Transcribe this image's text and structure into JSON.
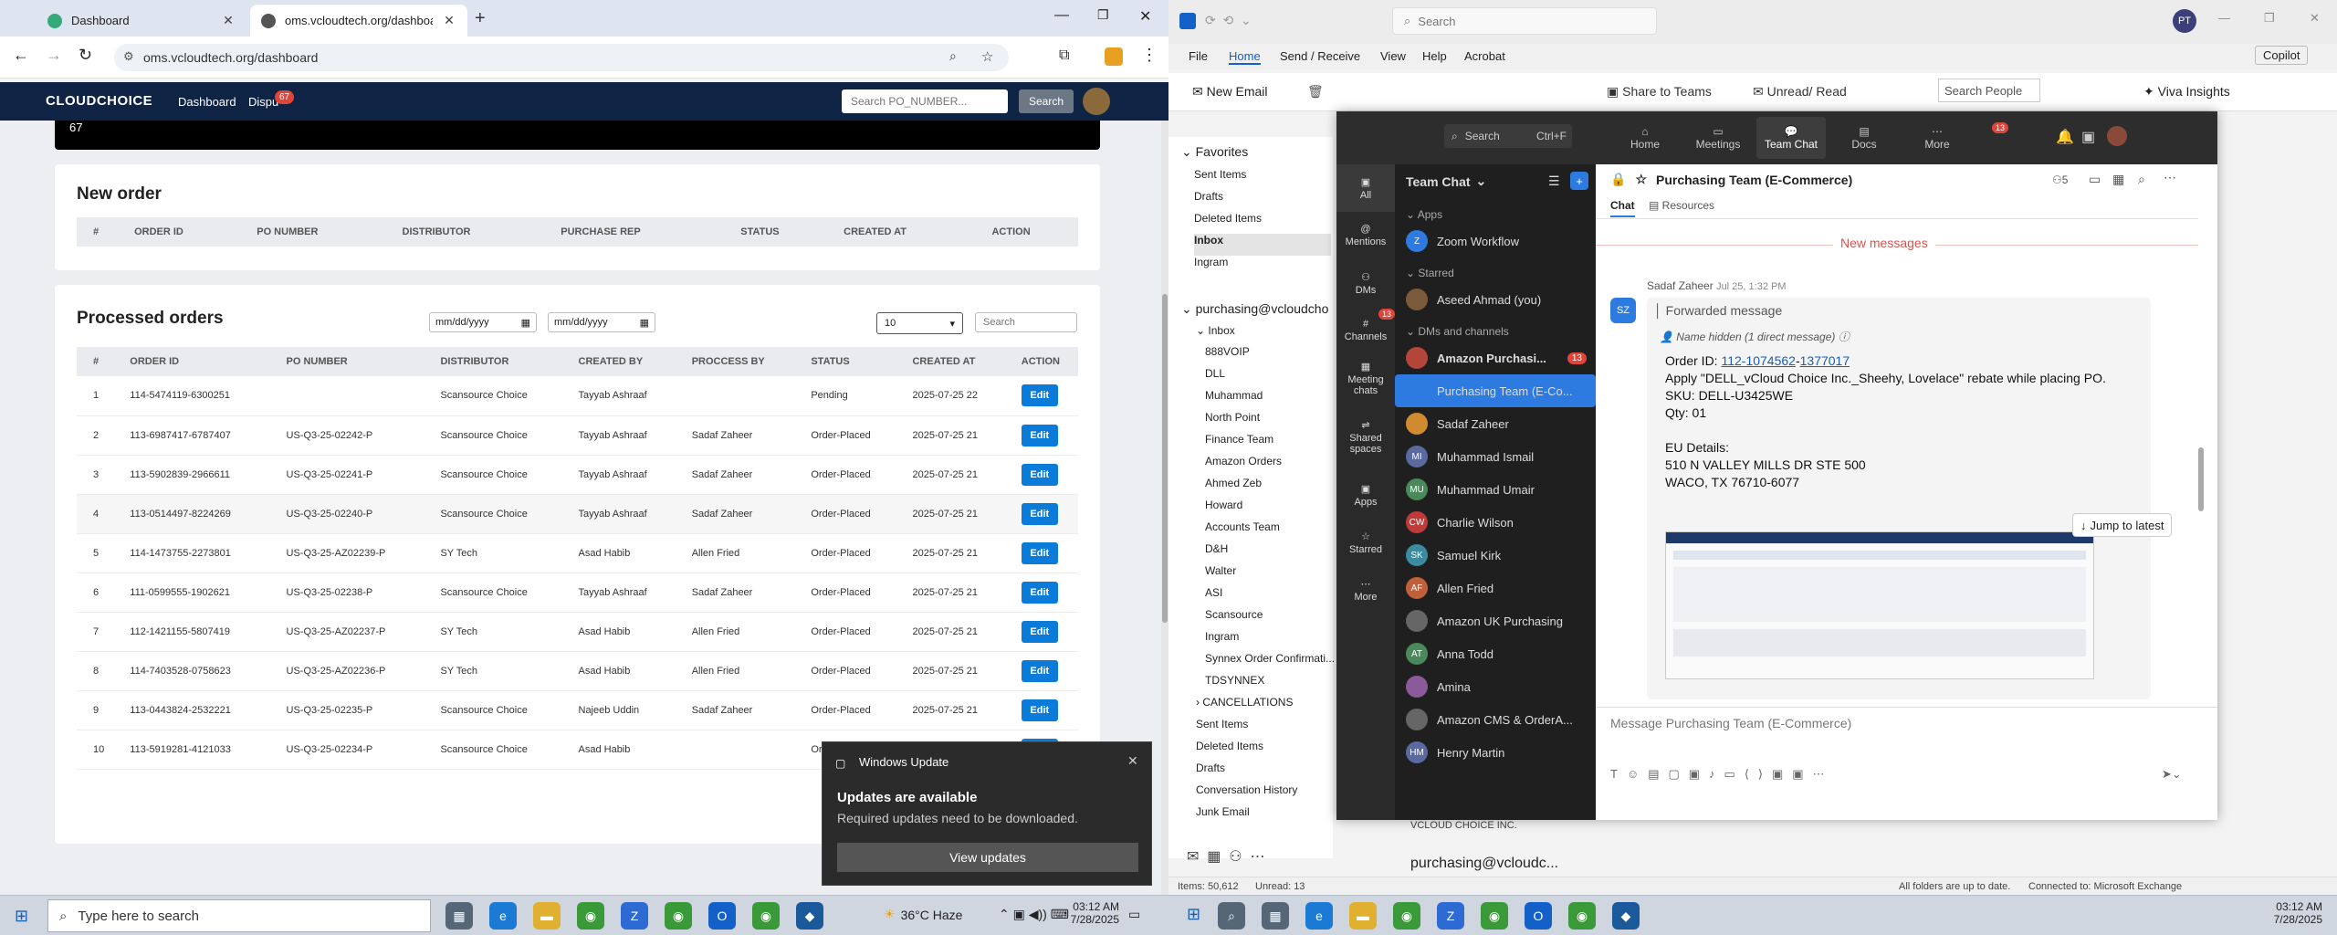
{
  "browser": {
    "tabs": [
      {
        "label": "Dashboard",
        "active": false
      },
      {
        "label": "oms.vcloudtech.org/dashboard",
        "active": true
      }
    ],
    "url": "oms.vcloudtech.org/dashboard",
    "app": {
      "logo": "CLOUDCHOICE",
      "nav_dashboard": "Dashboard",
      "nav_disputes": "Dispu",
      "disputes_count": "67",
      "search_placeholder": "Search PO_NUMBER...",
      "search_btn": "Search",
      "top_card_number": "67"
    },
    "new_order": {
      "title": "New order",
      "headers": [
        "#",
        "ORDER ID",
        "PO NUMBER",
        "DISTRIBUTOR",
        "PURCHASE REP",
        "STATUS",
        "CREATED AT",
        "ACTION"
      ]
    },
    "processed": {
      "title": "Processed orders",
      "date_placeholder_1": "mm/dd/yyyy",
      "date_placeholder_2": "mm/dd/yyyy",
      "page_size": "10",
      "search_placeholder": "Search",
      "headers": [
        "#",
        "ORDER ID",
        "PO NUMBER",
        "DISTRIBUTOR",
        "CREATED BY",
        "PROCCESS BY",
        "STATUS",
        "CREATED AT",
        "ACTION"
      ],
      "rows": [
        [
          "1",
          "114-5474119-6300251",
          "",
          "Scansource Choice",
          "Tayyab Ashraaf",
          "",
          "Pending",
          "2025-07-25 22",
          "Edit"
        ],
        [
          "2",
          "113-6987417-6787407",
          "US-Q3-25-02242-P",
          "Scansource Choice",
          "Tayyab Ashraaf",
          "Sadaf Zaheer",
          "Order-Placed",
          "2025-07-25 21",
          "Edit"
        ],
        [
          "3",
          "113-5902839-2966611",
          "US-Q3-25-02241-P",
          "Scansource Choice",
          "Tayyab Ashraaf",
          "Sadaf Zaheer",
          "Order-Placed",
          "2025-07-25 21",
          "Edit"
        ],
        [
          "4",
          "113-0514497-8224269",
          "US-Q3-25-02240-P",
          "Scansource Choice",
          "Tayyab Ashraaf",
          "Sadaf Zaheer",
          "Order-Placed",
          "2025-07-25 21",
          "Edit"
        ],
        [
          "5",
          "114-1473755-2273801",
          "US-Q3-25-AZ02239-P",
          "SY Tech",
          "Asad Habib",
          "Allen Fried",
          "Order-Placed",
          "2025-07-25 21",
          "Edit"
        ],
        [
          "6",
          "111-0599555-1902621",
          "US-Q3-25-02238-P",
          "Scansource Choice",
          "Tayyab Ashraaf",
          "Sadaf Zaheer",
          "Order-Placed",
          "2025-07-25 21",
          "Edit"
        ],
        [
          "7",
          "112-1421155-5807419",
          "US-Q3-25-AZ02237-P",
          "SY Tech",
          "Asad Habib",
          "Allen Fried",
          "Order-Placed",
          "2025-07-25 21",
          "Edit"
        ],
        [
          "8",
          "114-7403528-0758623",
          "US-Q3-25-AZ02236-P",
          "SY Tech",
          "Asad Habib",
          "Allen Fried",
          "Order-Placed",
          "2025-07-25 21",
          "Edit"
        ],
        [
          "9",
          "113-0443824-2532221",
          "US-Q3-25-02235-P",
          "Scansource Choice",
          "Najeeb Uddin",
          "Sadaf Zaheer",
          "Order-Placed",
          "2025-07-25 21",
          "Edit"
        ],
        [
          "10",
          "113-5919281-4121033",
          "US-Q3-25-02234-P",
          "Scansource Choice",
          "Asad Habib",
          "",
          "Order",
          "",
          "Edit"
        ]
      ]
    }
  },
  "winupdate": {
    "app": "Windows Update",
    "title": "Updates are available",
    "body": "Required updates need to be downloaded.",
    "button": "View updates"
  },
  "outlook": {
    "search_placeholder": "Search",
    "avatar": "PT",
    "copilot": "Copilot",
    "menu": [
      "File",
      "Home",
      "Send / Receive",
      "View",
      "Help",
      "Acrobat"
    ],
    "ribbon": {
      "new_email": "New Email",
      "share_teams": "Share to Teams",
      "unread_read": "Unread/ Read",
      "search_people": "Search People",
      "viva": "Viva Insights"
    },
    "favorites_label": "Favorites",
    "favorites": [
      "Sent Items",
      "Drafts",
      "Deleted Items",
      "Inbox",
      "Ingram"
    ],
    "account": "purchasing@vcloudcho",
    "inbox_label": "Inbox",
    "folders": [
      "888VOIP",
      "DLL",
      "Muhammad",
      "North Point",
      "Finance Team",
      "Amazon Orders",
      "Ahmed Zeb",
      "Howard",
      "Accounts Team",
      "D&H",
      "Walter",
      "ASI",
      "Scansource",
      "Ingram",
      "Synnex Order Confirmati...",
      "TDSYNNEX"
    ],
    "cancellations": "CANCELLATIONS",
    "folders2": [
      "Sent Items",
      "Deleted Items",
      "Drafts",
      "Conversation History",
      "Junk Email"
    ],
    "list_peek_1": "VCLOUD CHOICE INC.",
    "list_peek_2": "purchasing@vcloudc...",
    "status": {
      "items": "Items: 50,612",
      "unread": "Unread: 13",
      "sync": "All folders are up to date.",
      "connected": "Connected to: Microsoft Exchange"
    }
  },
  "teams": {
    "search": "Search",
    "shortcut": "Ctrl+F",
    "top_nav": [
      "Home",
      "Meetings",
      "Team Chat",
      "Docs",
      "More"
    ],
    "team_chat_badge": "13",
    "rail": [
      "All",
      "Mentions",
      "DMs",
      "Channels",
      "Meeting chats",
      "Shared spaces",
      "Apps",
      "Starred",
      "More"
    ],
    "channels_badge": "13",
    "list_title": "Team Chat",
    "sec_apps": "Apps",
    "app_zoom": "Zoom Workflow",
    "sec_starred": "Starred",
    "starred_1": "Aseed Ahmad (you)",
    "sec_dms": "DMs and channels",
    "channels": [
      {
        "name": "Amazon Purchasi...",
        "badge": "13",
        "bold": true
      },
      {
        "name": "Purchasing Team (E-Co...",
        "selected": true
      },
      {
        "name": "Sadaf Zaheer"
      },
      {
        "name": "Muhammad Ismail",
        "av": "MI"
      },
      {
        "name": "Muhammad Umair",
        "av": "MU"
      },
      {
        "name": "Charlie Wilson",
        "av": "CW"
      },
      {
        "name": "Samuel Kirk",
        "av": "SK"
      },
      {
        "name": "Allen Fried",
        "av": "AF"
      },
      {
        "name": "Amazon UK Purchasing"
      },
      {
        "name": "Anna Todd",
        "av": "AT"
      },
      {
        "name": "Amina"
      },
      {
        "name": "Amazon CMS & OrderA..."
      },
      {
        "name": "Henry Martin",
        "av": "HM"
      }
    ],
    "chat_title": "Purchasing Team (E-Commerce)",
    "members": "5",
    "tab_chat": "Chat",
    "tab_resources": "Resources",
    "new_messages": "New messages",
    "sender": "Sadaf Zaheer",
    "sender_av": "SZ",
    "time": "Jul 25, 1:32 PM",
    "forwarded": "Forwarded message",
    "hidden": "Name hidden (1 direct message)",
    "order_prefix": "Order ID: ",
    "order_link_1": "112-1074562",
    "order_link_2": "1377017",
    "line1": "Apply \"DELL_vCloud Choice Inc._Sheehy, Lovelace\" rebate while placing PO.",
    "line2": "SKU: DELL-U3425WE",
    "line3": "Qty: 01",
    "line4": "EU Details:",
    "line5": "510 N VALLEY MILLS DR STE 500",
    "line6": "WACO, TX 76710-6077",
    "jump": "Jump to latest",
    "composer": "Message Purchasing Team (E-Commerce)"
  },
  "taskbar": {
    "search": "Type here to search",
    "weather": "36°C  Haze",
    "time": "03:12 AM",
    "date": "7/28/2025",
    "time2": "03:12 AM",
    "date2": "7/28/2025"
  },
  "colors": {
    "nav": "#0f2444",
    "edit": "#0a7bd8",
    "badge": "#e0453a",
    "teams_accent": "#2d7be0"
  }
}
